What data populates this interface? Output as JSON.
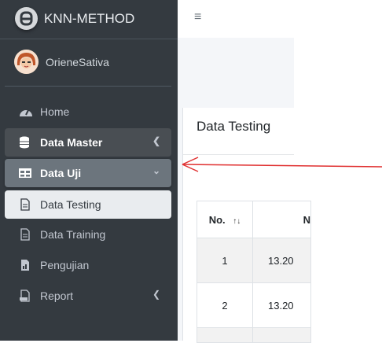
{
  "brand": {
    "name": "KNN-METHOD"
  },
  "user": {
    "name": "OrieneSativa"
  },
  "sidebar": {
    "items": [
      {
        "label": "Home",
        "icon": "tachometer-icon"
      },
      {
        "label": "Data Master",
        "icon": "database-icon",
        "chevron": "left"
      },
      {
        "label": "Data Uji",
        "icon": "table-icon",
        "chevron": "down"
      },
      {
        "label": "Data Testing",
        "icon": "file-icon"
      },
      {
        "label": "Data Training",
        "icon": "file-icon"
      },
      {
        "label": "Pengujian",
        "icon": "chart-file-icon"
      },
      {
        "label": "Report",
        "icon": "report-file-icon",
        "chevron": "left"
      }
    ]
  },
  "topbar": {
    "menu_icon": "≡"
  },
  "card": {
    "title": "Data Testing"
  },
  "table": {
    "headers": [
      "No.",
      "N"
    ],
    "sort_icon": "↑↓",
    "rows": [
      [
        "1",
        "13.20"
      ],
      [
        "2",
        "13.20"
      ],
      [
        "",
        ""
      ]
    ]
  },
  "colors": {
    "sidebar": "#343a40",
    "active": "#e9ecef",
    "arrow": "#e03030"
  }
}
